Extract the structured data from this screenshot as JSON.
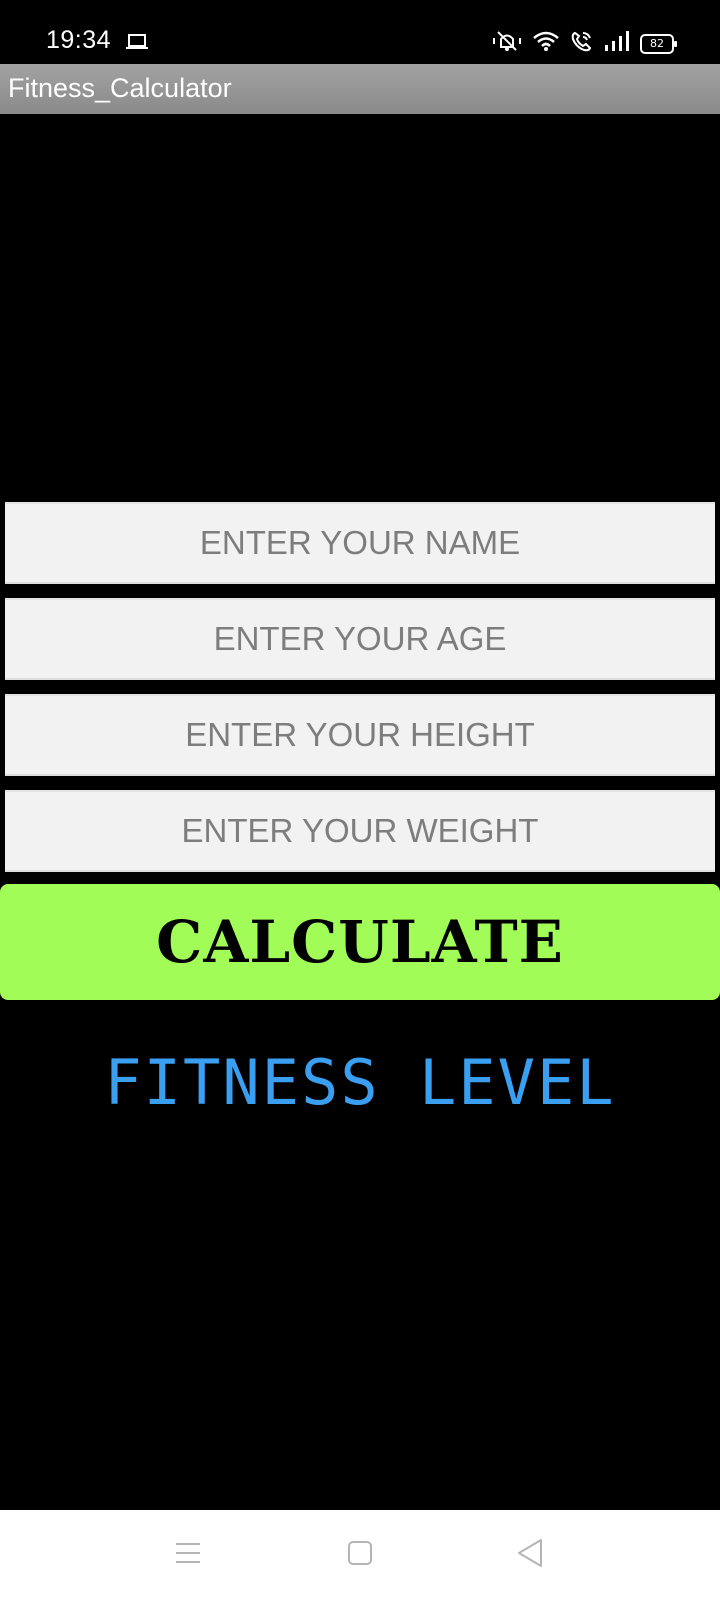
{
  "status_bar": {
    "time": "19:34",
    "battery": "82",
    "icons": [
      "laptop-icon",
      "vibrate-mute-icon",
      "wifi-icon",
      "wifi-call-icon",
      "signal-icon",
      "battery-icon"
    ]
  },
  "app_bar": {
    "title": "Fitness_Calculator"
  },
  "form": {
    "name_placeholder": "ENTER YOUR NAME",
    "age_placeholder": "ENTER YOUR AGE",
    "height_placeholder": "ENTER YOUR HEIGHT",
    "weight_placeholder": "ENTER YOUR WEIGHT",
    "name_value": "",
    "age_value": "",
    "height_value": "",
    "weight_value": ""
  },
  "calculate_label": "CALCULATE",
  "result_label": "FITNESS LEVEL",
  "colors": {
    "background": "#000000",
    "app_bar": "#999999",
    "button": "#a1fc57",
    "result_text": "#3a9ff1",
    "field_bg": "#f2f2f2"
  },
  "nav_bar": {
    "icons": [
      "menu-icon",
      "home-icon",
      "back-icon"
    ]
  }
}
